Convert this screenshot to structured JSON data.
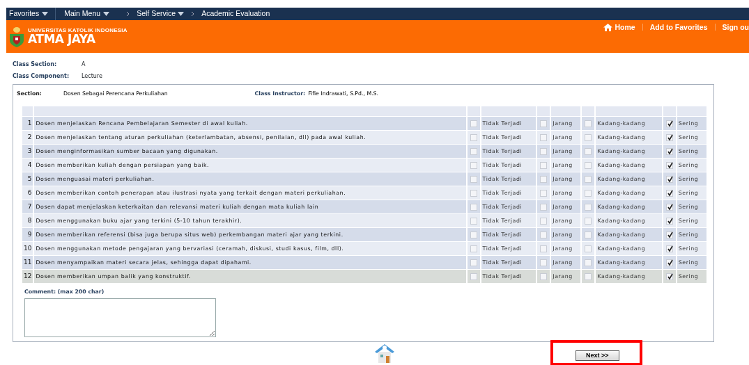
{
  "top_nav": {
    "items": [
      {
        "label": "Favorites",
        "dropdown": true
      },
      {
        "label": "Main Menu",
        "dropdown": true
      }
    ],
    "breadcrumb": [
      {
        "label": "Self Service",
        "dropdown": true
      },
      {
        "label": "Academic Evaluation",
        "dropdown": false
      }
    ]
  },
  "header": {
    "logo_small": "UNIVERSITAS KATOLIK INDONESIA",
    "logo_text": "ATMA JAYA",
    "links": [
      {
        "label": "Home",
        "kind": "home"
      },
      {
        "label": "Add to Favorites",
        "kind": "plain"
      },
      {
        "label": "Sign ou",
        "kind": "plain"
      }
    ]
  },
  "class_info": [
    {
      "label": "Class Section:",
      "value": "A"
    },
    {
      "label": "Class Component:",
      "value": "Lecture"
    }
  ],
  "section": {
    "label": "Section:",
    "value": "Dosen Sebagai Perencana Perkuliahan",
    "instructor_label": "Class Instructor:",
    "instructor": "Fifie Indrawati, S.Pd., M.S."
  },
  "rows": [
    {
      "number": "1",
      "text": "Dosen menjelaskan Rencana Pembelajaran Semester di awal kuliah.",
      "selected": false,
      "options": [
        {
          "label": "Tidak Terjadi",
          "checked": false
        },
        {
          "label": "Jarang",
          "checked": false
        },
        {
          "label": "Kadang-kadang",
          "checked": false
        },
        {
          "label": "Sering",
          "checked": true
        }
      ]
    },
    {
      "number": "2",
      "text": "Dosen menjelaskan tentang aturan perkuliahan (keterlambatan, absensi, penilaian, dll) pada awal kuliah.",
      "selected": false,
      "options": [
        {
          "label": "Tidak Terjadi",
          "checked": false
        },
        {
          "label": "Jarang",
          "checked": false
        },
        {
          "label": "Kadang-kadang",
          "checked": false
        },
        {
          "label": "Sering",
          "checked": true
        }
      ]
    },
    {
      "number": "3",
      "text": "Dosen menginformasikan sumber bacaan yang digunakan.",
      "selected": false,
      "options": [
        {
          "label": "Tidak Terjadi",
          "checked": false
        },
        {
          "label": "Jarang",
          "checked": false
        },
        {
          "label": "Kadang-kadang",
          "checked": false
        },
        {
          "label": "Sering",
          "checked": true
        }
      ]
    },
    {
      "number": "4",
      "text": "Dosen memberikan kuliah dengan persiapan yang baik.",
      "selected": false,
      "options": [
        {
          "label": "Tidak Terjadi",
          "checked": false
        },
        {
          "label": "Jarang",
          "checked": false
        },
        {
          "label": "Kadang-kadang",
          "checked": false
        },
        {
          "label": "Sering",
          "checked": true
        }
      ]
    },
    {
      "number": "5",
      "text": "Dosen menguasai materi perkuliahan.",
      "selected": false,
      "options": [
        {
          "label": "Tidak Terjadi",
          "checked": false
        },
        {
          "label": "Jarang",
          "checked": false
        },
        {
          "label": "Kadang-kadang",
          "checked": false
        },
        {
          "label": "Sering",
          "checked": true
        }
      ]
    },
    {
      "number": "6",
      "text": "Dosen memberikan contoh penerapan atau ilustrasi nyata yang terkait dengan materi perkuliahan.",
      "selected": false,
      "options": [
        {
          "label": "Tidak Terjadi",
          "checked": false
        },
        {
          "label": "Jarang",
          "checked": false
        },
        {
          "label": "Kadang-kadang",
          "checked": false
        },
        {
          "label": "Sering",
          "checked": true
        }
      ]
    },
    {
      "number": "7",
      "text": "Dosen dapat menjelaskan keterkaitan dan relevansi materi kuliah dengan mata kuliah lain",
      "selected": false,
      "options": [
        {
          "label": "Tidak Terjadi",
          "checked": false
        },
        {
          "label": "Jarang",
          "checked": false
        },
        {
          "label": "Kadang-kadang",
          "checked": false
        },
        {
          "label": "Sering",
          "checked": true
        }
      ]
    },
    {
      "number": "8",
      "text": "Dosen menggunakan buku ajar yang terkini (5-10 tahun terakhir).",
      "selected": false,
      "options": [
        {
          "label": "Tidak Terjadi",
          "checked": false
        },
        {
          "label": "Jarang",
          "checked": false
        },
        {
          "label": "Kadang-kadang",
          "checked": false
        },
        {
          "label": "Sering",
          "checked": true
        }
      ]
    },
    {
      "number": "9",
      "text": "Dosen memberikan referensi (bisa juga berupa situs web) perkembangan materi ajar yang terkini.",
      "selected": false,
      "options": [
        {
          "label": "Tidak Terjadi",
          "checked": false
        },
        {
          "label": "Jarang",
          "checked": false
        },
        {
          "label": "Kadang-kadang",
          "checked": false
        },
        {
          "label": "Sering",
          "checked": true
        }
      ]
    },
    {
      "number": "10",
      "text": "Dosen menggunakan metode pengajaran yang bervariasi (ceramah, diskusi, studi kasus, film, dll).",
      "selected": false,
      "options": [
        {
          "label": "Tidak Terjadi",
          "checked": false
        },
        {
          "label": "Jarang",
          "checked": false
        },
        {
          "label": "Kadang-kadang",
          "checked": false
        },
        {
          "label": "Sering",
          "checked": true
        }
      ]
    },
    {
      "number": "11",
      "text": "Dosen menyampaikan materi secara jelas, sehingga dapat dipahami.",
      "selected": false,
      "options": [
        {
          "label": "Tidak Terjadi",
          "checked": false
        },
        {
          "label": "Jarang",
          "checked": false
        },
        {
          "label": "Kadang-kadang",
          "checked": false
        },
        {
          "label": "Sering",
          "checked": true
        }
      ]
    },
    {
      "number": "12",
      "text": "Dosen memberikan umpan balik yang konstruktif.",
      "selected": true,
      "options": [
        {
          "label": "Tidak Terjadi",
          "checked": false
        },
        {
          "label": "Jarang",
          "checked": false
        },
        {
          "label": "Kadang-kadang",
          "checked": false
        },
        {
          "label": "Sering",
          "checked": true
        }
      ]
    }
  ],
  "comment": {
    "label": "Comment: (max 200 char)"
  },
  "next_button": {
    "label": "Next >>",
    "highlighted": true
  }
}
